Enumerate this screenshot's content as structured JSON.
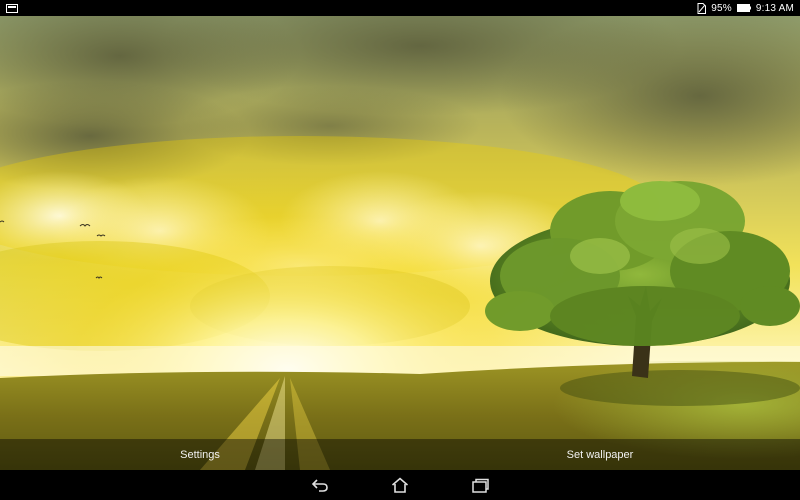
{
  "status_bar": {
    "battery_percent": "95%",
    "time": "9:13 AM",
    "icons": {
      "left": "notification-icon",
      "sim": "no-sim-icon",
      "battery": "battery-icon"
    }
  },
  "wallpaper": {
    "description_icon": "wallpaper-preview",
    "colors": {
      "sky_bright": "#fff7a8",
      "sky_gold": "#e8c700",
      "cloud_dark": "#6f7040",
      "grass": "#8a8a1e",
      "tree": "#5f8a20"
    }
  },
  "actions": {
    "settings_label": "Settings",
    "set_wallpaper_label": "Set wallpaper"
  },
  "nav_bar": {
    "icons": [
      "back-icon",
      "home-icon",
      "recent-apps-icon"
    ]
  }
}
